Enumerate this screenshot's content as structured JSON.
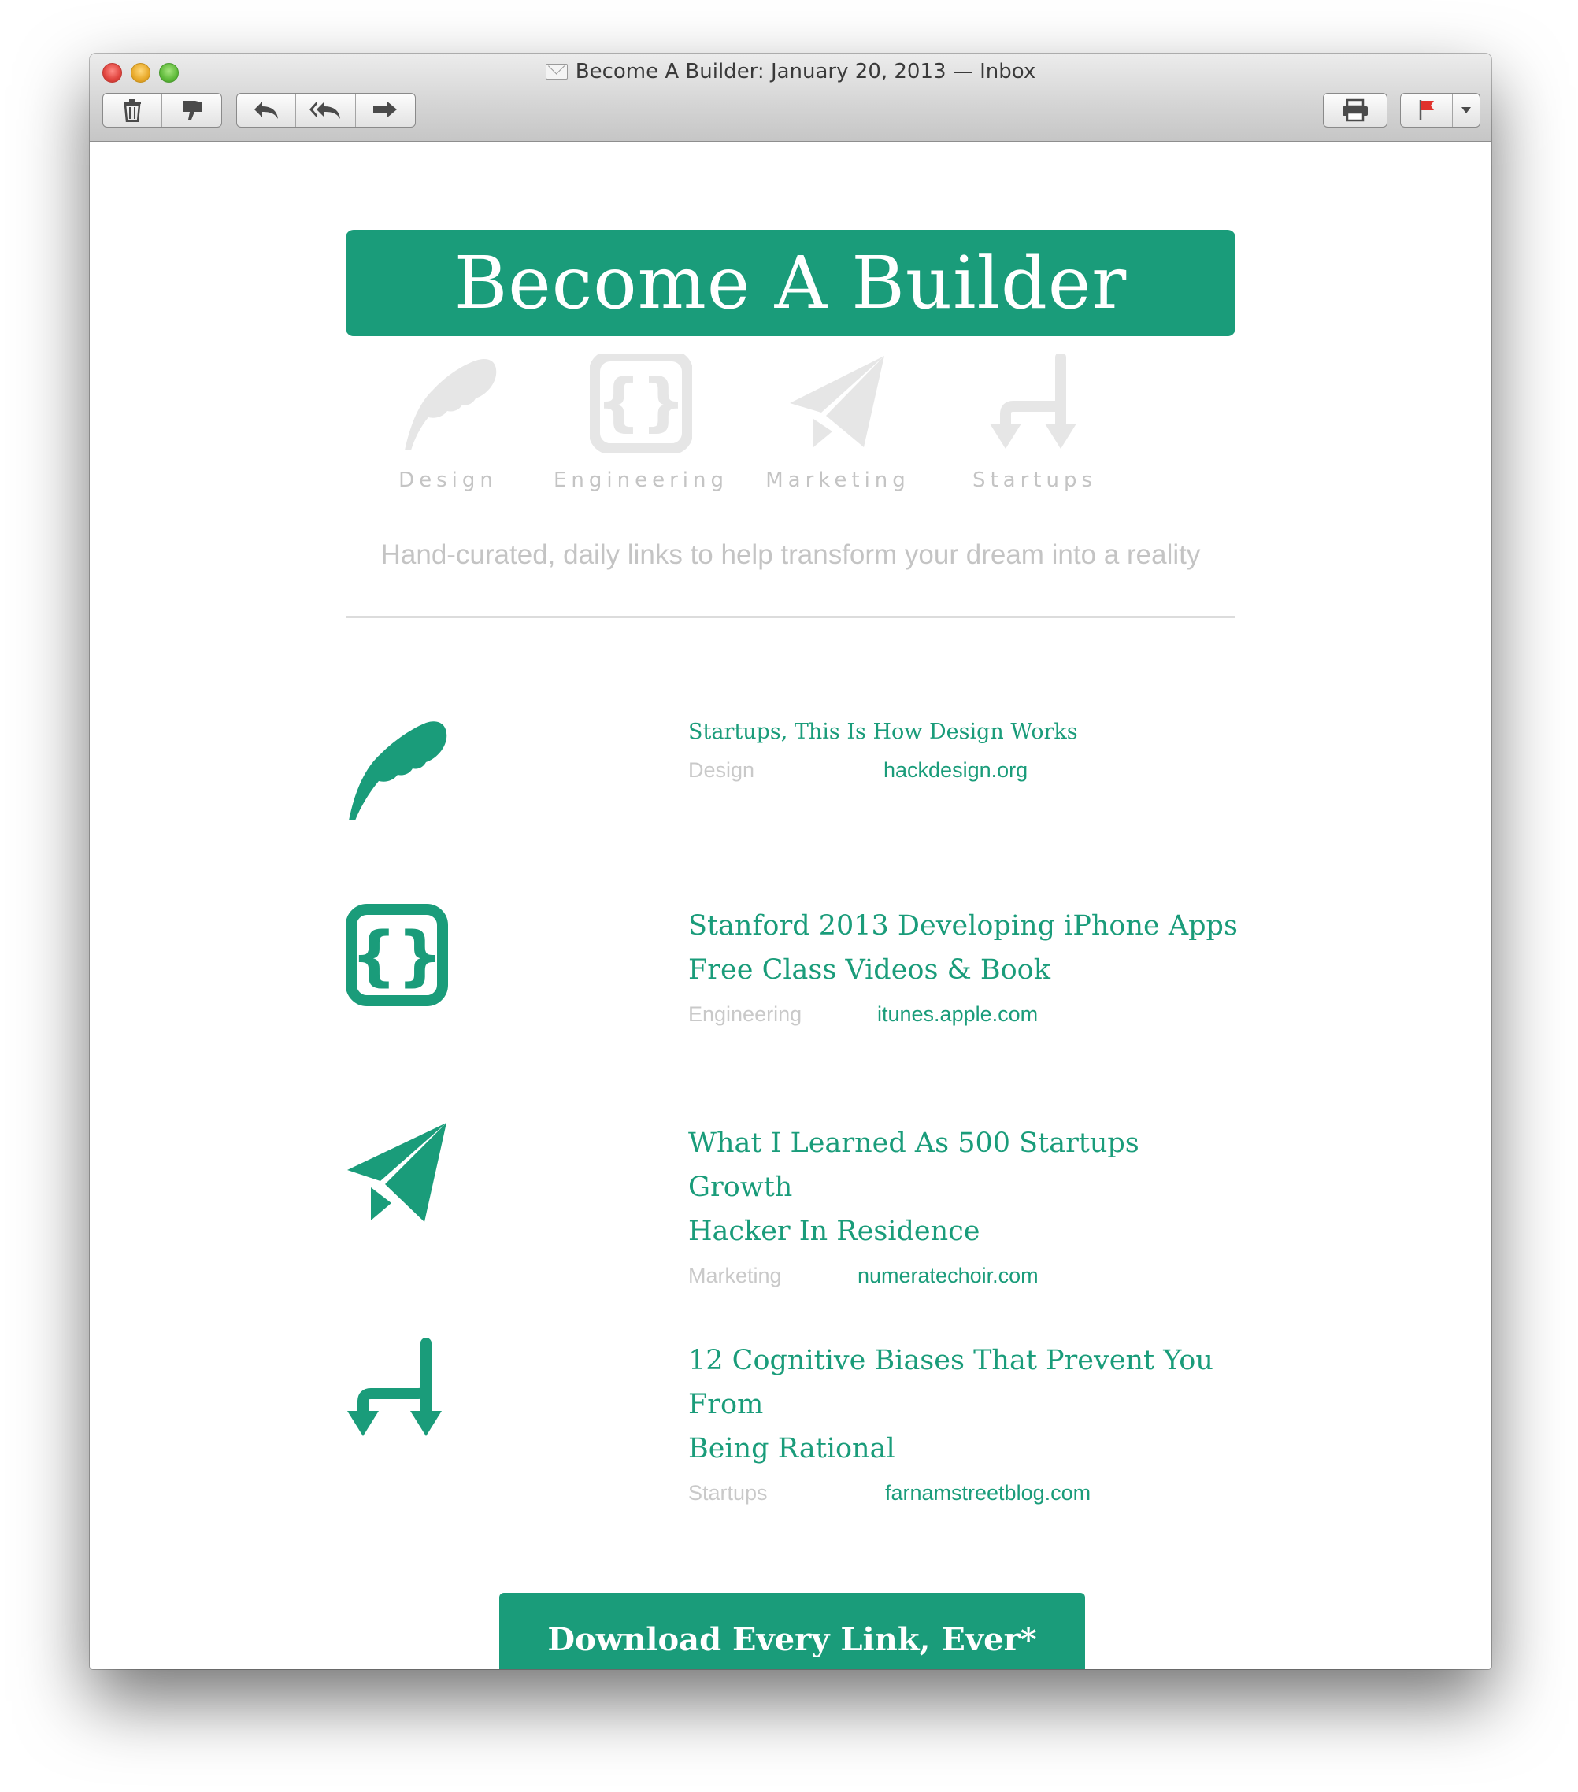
{
  "window": {
    "title": "Become A Builder: January 20, 2013 — Inbox",
    "toolbar": {
      "delete_icon": "trash-icon",
      "junk_icon": "thumbs-down-icon",
      "reply_icon": "reply-icon",
      "reply_all_icon": "reply-all-icon",
      "forward_icon": "forward-icon",
      "print_icon": "printer-icon",
      "flag_icon": "flag-icon",
      "flag_menu_icon": "chevron-down-icon"
    }
  },
  "email": {
    "header_title": "Become A Builder",
    "categories": [
      {
        "label": "Design",
        "icon": "feather-icon"
      },
      {
        "label": "Engineering",
        "icon": "braces-icon"
      },
      {
        "label": "Marketing",
        "icon": "paper-plane-icon"
      },
      {
        "label": "Startups",
        "icon": "fork-arrows-icon"
      }
    ],
    "tagline": "Hand-curated, daily links to help transform your dream into a reality",
    "links": [
      {
        "title": "Startups, This Is How Design Works",
        "category": "Design",
        "url": "hackdesign.org"
      },
      {
        "title_line1": "Stanford 2013 Developing iPhone Apps",
        "title_line2": "Free Class Videos & Book",
        "category": "Engineering",
        "url": "itunes.apple.com"
      },
      {
        "title_line1": "What I Learned As 500 Startups Growth",
        "title_line2": "Hacker In Residence",
        "category": "Marketing",
        "url": "numeratechoir.com"
      },
      {
        "title_line1": "12 Cognitive Biases That Prevent You From",
        "title_line2": "Being Rational",
        "category": "Startups",
        "url": "farnamstreetblog.com"
      }
    ],
    "cta_label": "Download Every Link, Ever*"
  },
  "colors": {
    "accent": "#1a9c7a",
    "muted": "#c4c4c4"
  }
}
